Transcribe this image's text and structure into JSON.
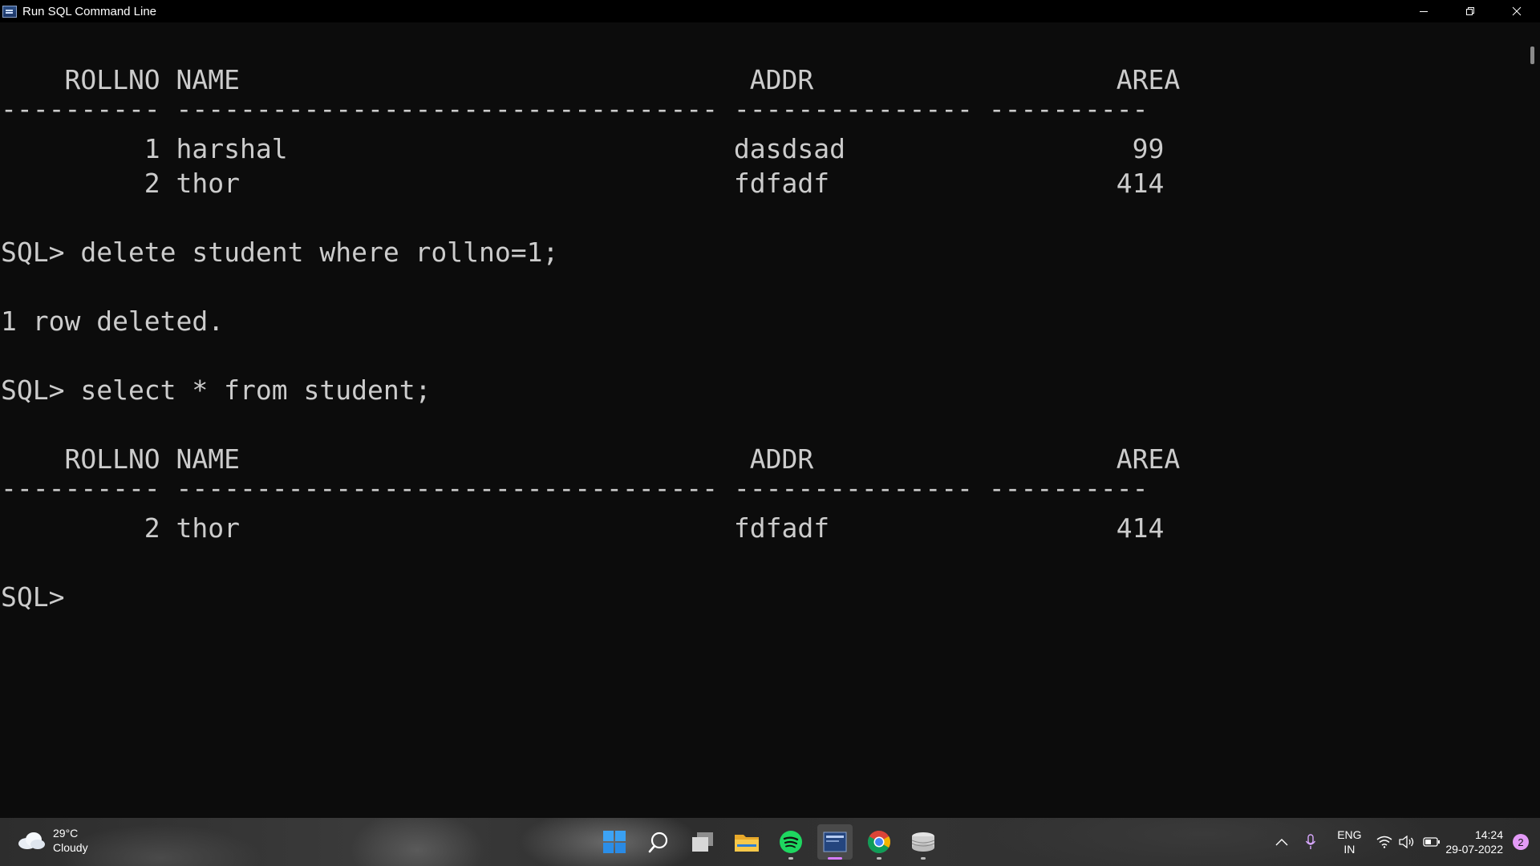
{
  "window": {
    "title": "Run SQL Command Line"
  },
  "console": {
    "lines": [
      "",
      "    ROLLNO NAME                                ADDR                   AREA",
      "---------- ---------------------------------- --------------- ----------",
      "         1 harshal                            dasdsad                  99",
      "         2 thor                               fdfadf                  414",
      "",
      "SQL> delete student where rollno=1;",
      "",
      "1 row deleted.",
      "",
      "SQL> select * from student;",
      "",
      "    ROLLNO NAME                                ADDR                   AREA",
      "---------- ---------------------------------- --------------- ----------",
      "         2 thor                               fdfadf                  414",
      "",
      "SQL>"
    ]
  },
  "taskbar": {
    "weather": {
      "temp": "29°C",
      "condition": "Cloudy",
      "icon": "cloud-icon"
    },
    "apps": [
      {
        "name": "start-icon"
      },
      {
        "name": "search-icon"
      },
      {
        "name": "task-view-icon"
      },
      {
        "name": "file-explorer-icon"
      },
      {
        "name": "spotify-icon"
      },
      {
        "name": "sql-command-line-icon"
      },
      {
        "name": "chrome-icon"
      },
      {
        "name": "database-icon"
      }
    ],
    "tray": {
      "language_line1": "ENG",
      "language_line2": "IN",
      "time": "14:24",
      "date": "29-07-2022",
      "notification_count": "2"
    }
  }
}
